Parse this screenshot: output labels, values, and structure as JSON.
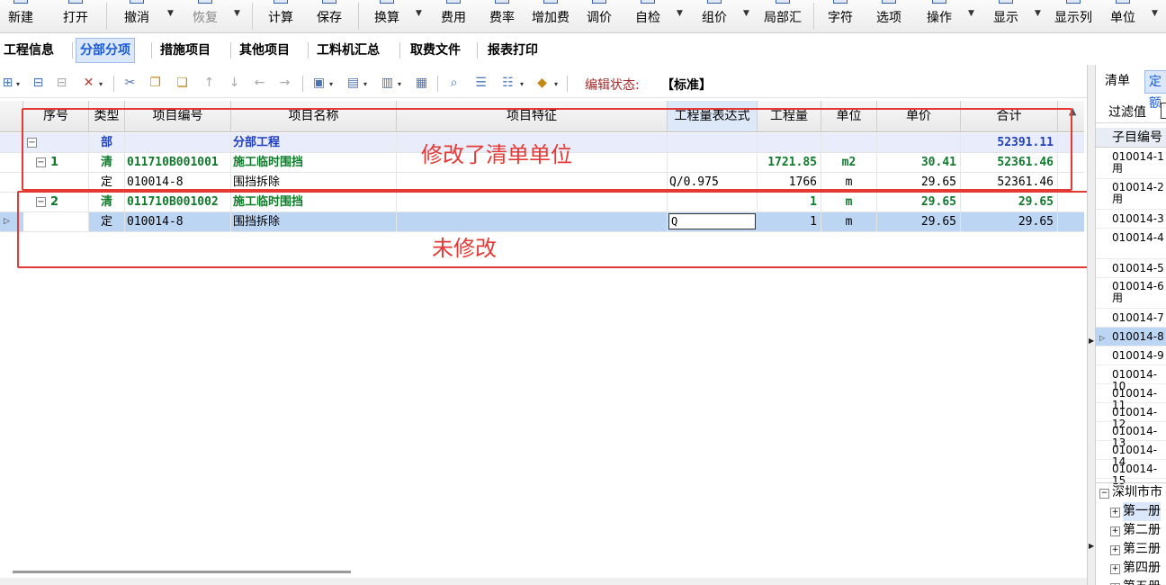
{
  "ribbon": {
    "buttons": [
      {
        "label": "新建",
        "icon": "new-file-icon"
      },
      {
        "label": "打开",
        "icon": "open-folder-icon"
      },
      {
        "label": "撤消",
        "icon": "undo-icon"
      },
      {
        "label": "恢复",
        "icon": "redo-icon",
        "disabled": true
      },
      {
        "label": "计算",
        "icon": "calculator-icon"
      },
      {
        "label": "保存",
        "icon": "save-icon"
      },
      {
        "label": "换算",
        "icon": "conversion-icon"
      },
      {
        "label": "费用",
        "icon": "cost-icon"
      },
      {
        "label": "费率",
        "icon": "rate-icon"
      },
      {
        "label": "增加费",
        "icon": "surcharge-icon"
      },
      {
        "label": "调价",
        "icon": "adjust-price-icon"
      },
      {
        "label": "自检",
        "icon": "self-check-icon"
      },
      {
        "label": "组价",
        "icon": "compose-price-icon"
      },
      {
        "label": "局部汇",
        "icon": "partial-summary-icon"
      },
      {
        "label": "字符",
        "icon": "character-icon"
      },
      {
        "label": "选项",
        "icon": "options-icon"
      },
      {
        "label": "操作",
        "icon": "operation-icon"
      },
      {
        "label": "显示",
        "icon": "display-icon"
      },
      {
        "label": "显示列",
        "icon": "display-columns-icon"
      },
      {
        "label": "单位",
        "icon": "unit-icon"
      }
    ]
  },
  "tabs": [
    "工程信息",
    "分部分项",
    "措施项目",
    "其他项目",
    "工料机汇总",
    "取费文件",
    "报表打印"
  ],
  "toolbar": {
    "edit_state_label": "编辑状态:",
    "edit_state_value": "【标准】"
  },
  "grid": {
    "columns": [
      "序号",
      "类型",
      "项目编号",
      "项目名称",
      "项目特征",
      "工程量表达式",
      "工程量",
      "单位",
      "单价",
      "合计"
    ],
    "rows": [
      {
        "kind": "bu",
        "seq": "",
        "type": "部",
        "code": "",
        "name": "分部工程",
        "feature": "",
        "expr": "",
        "qty": "",
        "unit": "",
        "price": "",
        "total": "52391.11"
      },
      {
        "kind": "qing",
        "seq": "1",
        "type": "清",
        "code": "011710B001001",
        "name": "施工临时围挡",
        "feature": "",
        "expr": "",
        "qty": "1721.85",
        "unit": "m2",
        "price": "30.41",
        "total": "52361.46"
      },
      {
        "kind": "ding",
        "seq": "",
        "type": "定",
        "code": "010014-8",
        "name": "围挡拆除",
        "feature": "",
        "expr": "Q/0.975",
        "qty": "1766",
        "unit": "m",
        "price": "29.65",
        "total": "52361.46"
      },
      {
        "kind": "qing",
        "seq": "2",
        "type": "清",
        "code": "011710B001002",
        "name": "施工临时围挡",
        "feature": "",
        "expr": "",
        "qty": "1",
        "unit": "m",
        "price": "29.65",
        "total": "29.65"
      },
      {
        "kind": "ding",
        "seq": "",
        "type": "定",
        "code": "010014-8",
        "name": "围挡拆除",
        "feature": "",
        "expr": "Q",
        "qty": "1",
        "unit": "m",
        "price": "29.65",
        "total": "29.65"
      }
    ]
  },
  "annotations": {
    "modified": "修改了清单单位",
    "unmodified": "未修改"
  },
  "right_panel": {
    "tabs": [
      "清单",
      "定额"
    ],
    "filter_label": "过滤值",
    "header": "子目编号",
    "rows": [
      "010014-1用",
      "010014-2用",
      "010014-3",
      "010014-4",
      "010014-5",
      "010014-6用",
      "010014-7",
      "010014-8",
      "010014-9",
      "010014-10",
      "010014-11",
      "010014-12",
      "010014-13",
      "010014-14",
      "010014-15"
    ],
    "tree": [
      "深圳市市",
      "第一册",
      "第二册",
      "第三册",
      "第四册",
      "第五册"
    ]
  }
}
